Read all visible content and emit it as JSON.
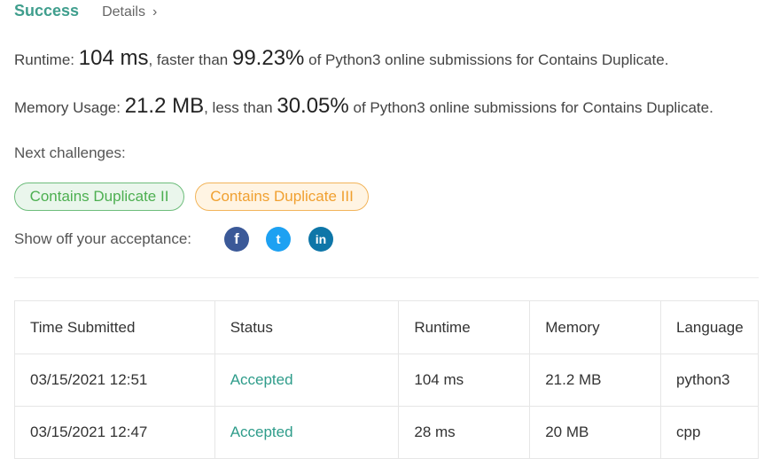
{
  "header": {
    "status": "Success",
    "details_label": "Details",
    "details_chevron": "›"
  },
  "runtime": {
    "label": "Runtime:",
    "value": "104 ms",
    "mid_text": ", faster than",
    "percent": "99.23%",
    "tail_text": "of Python3 online submissions for Contains Duplicate."
  },
  "memory": {
    "label": "Memory Usage:",
    "value": "21.2 MB",
    "mid_text": ", less than",
    "percent": "30.05%",
    "tail_text": "of Python3 online submissions for Contains Duplicate."
  },
  "next": {
    "label": "Next challenges:",
    "challenges": [
      "Contains Duplicate II",
      "Contains Duplicate III"
    ]
  },
  "share": {
    "label": "Show off your acceptance:",
    "icons": [
      {
        "name": "facebook-icon",
        "glyph": "f"
      },
      {
        "name": "twitter-icon",
        "glyph": "t"
      },
      {
        "name": "linkedin-icon",
        "glyph": "in"
      }
    ]
  },
  "submissions": {
    "headers": [
      "Time Submitted",
      "Status",
      "Runtime",
      "Memory",
      "Language"
    ],
    "rows": [
      [
        "03/15/2021 12:51",
        "Accepted",
        "104 ms",
        "21.2 MB",
        "python3"
      ],
      [
        "03/15/2021 12:47",
        "Accepted",
        "28 ms",
        "20 MB",
        "cpp"
      ]
    ]
  },
  "colors": {
    "success": "#3f9e8d",
    "accepted": "#2e9c8a",
    "green_pill": "#4caf50",
    "orange_pill": "#f0a030"
  }
}
